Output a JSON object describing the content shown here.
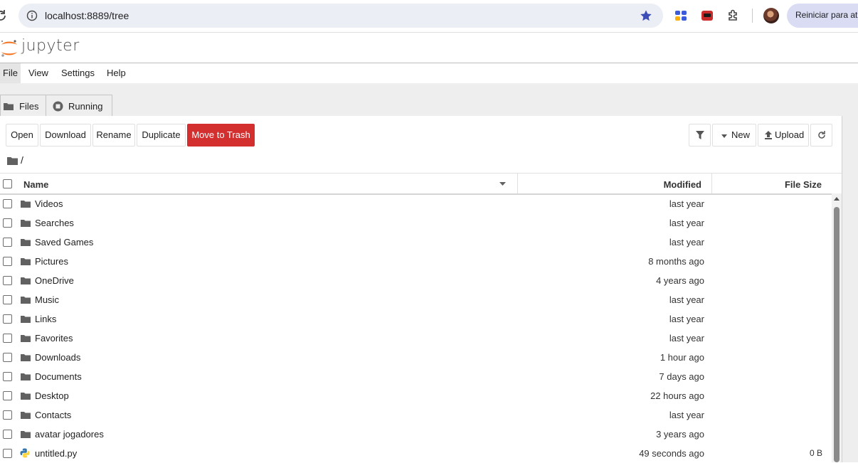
{
  "browser": {
    "url": "localhost:8889/tree",
    "update_button": "Reiniciar para atu"
  },
  "jupyter": {
    "wordmark": "jupyter",
    "menu": [
      "File",
      "View",
      "Settings",
      "Help"
    ],
    "tabs": [
      {
        "label": "Files",
        "icon": "folder-icon"
      },
      {
        "label": "Running",
        "icon": "stop-circle-icon"
      }
    ],
    "toolbar": {
      "open": "Open",
      "download": "Download",
      "rename": "Rename",
      "duplicate": "Duplicate",
      "trash": "Move to Trash",
      "new": "New",
      "upload": "Upload"
    },
    "breadcrumb": "/",
    "columns": {
      "name": "Name",
      "modified": "Modified",
      "size": "File Size"
    },
    "files": [
      {
        "name": "Videos",
        "type": "folder",
        "modified": "last year",
        "size": ""
      },
      {
        "name": "Searches",
        "type": "folder",
        "modified": "last year",
        "size": ""
      },
      {
        "name": "Saved Games",
        "type": "folder",
        "modified": "last year",
        "size": ""
      },
      {
        "name": "Pictures",
        "type": "folder",
        "modified": "8 months ago",
        "size": ""
      },
      {
        "name": "OneDrive",
        "type": "folder",
        "modified": "4 years ago",
        "size": ""
      },
      {
        "name": "Music",
        "type": "folder",
        "modified": "last year",
        "size": ""
      },
      {
        "name": "Links",
        "type": "folder",
        "modified": "last year",
        "size": ""
      },
      {
        "name": "Favorites",
        "type": "folder",
        "modified": "last year",
        "size": ""
      },
      {
        "name": "Downloads",
        "type": "folder",
        "modified": "1 hour ago",
        "size": ""
      },
      {
        "name": "Documents",
        "type": "folder",
        "modified": "7 days ago",
        "size": ""
      },
      {
        "name": "Desktop",
        "type": "folder",
        "modified": "22 hours ago",
        "size": ""
      },
      {
        "name": "Contacts",
        "type": "folder",
        "modified": "last year",
        "size": ""
      },
      {
        "name": "avatar jogadores",
        "type": "folder",
        "modified": "3 years ago",
        "size": ""
      },
      {
        "name": "untitled.py",
        "type": "python",
        "modified": "49 seconds ago",
        "size": "0 B"
      }
    ]
  },
  "colors": {
    "danger": "#d32f2f",
    "jupyter_orange": "#f37726",
    "star": "#3d4db8"
  }
}
